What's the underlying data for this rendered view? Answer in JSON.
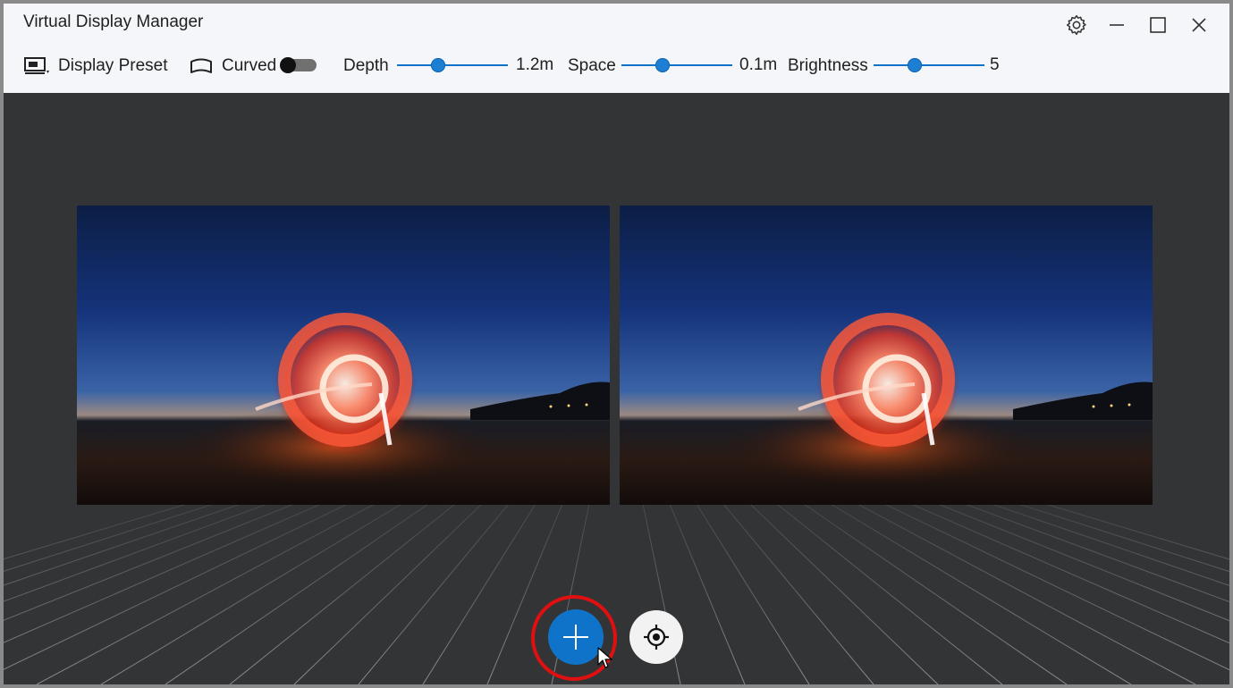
{
  "window": {
    "title": "Virtual Display Manager"
  },
  "toolbar": {
    "preset_label": "Display Preset",
    "curved_label": "Curved",
    "curved_on": false,
    "depth_label": "Depth",
    "depth_value": "1.2m",
    "depth_level": 0.35,
    "space_label": "Space",
    "space_value": "0.1m",
    "space_level": 0.35,
    "brightness_label": "Brightness",
    "brightness_value": "5",
    "brightness_level": 0.35
  },
  "icons": {
    "settings": "gear-icon",
    "minimize": "minimize-icon",
    "maximize": "maximize-icon",
    "close": "close-icon",
    "preset": "display-preset-icon",
    "curved": "curved-display-icon",
    "add": "plus-icon",
    "recenter": "crosshair-icon"
  },
  "colors": {
    "accent": "#0f74c9",
    "highlight_ring": "#e01010"
  }
}
